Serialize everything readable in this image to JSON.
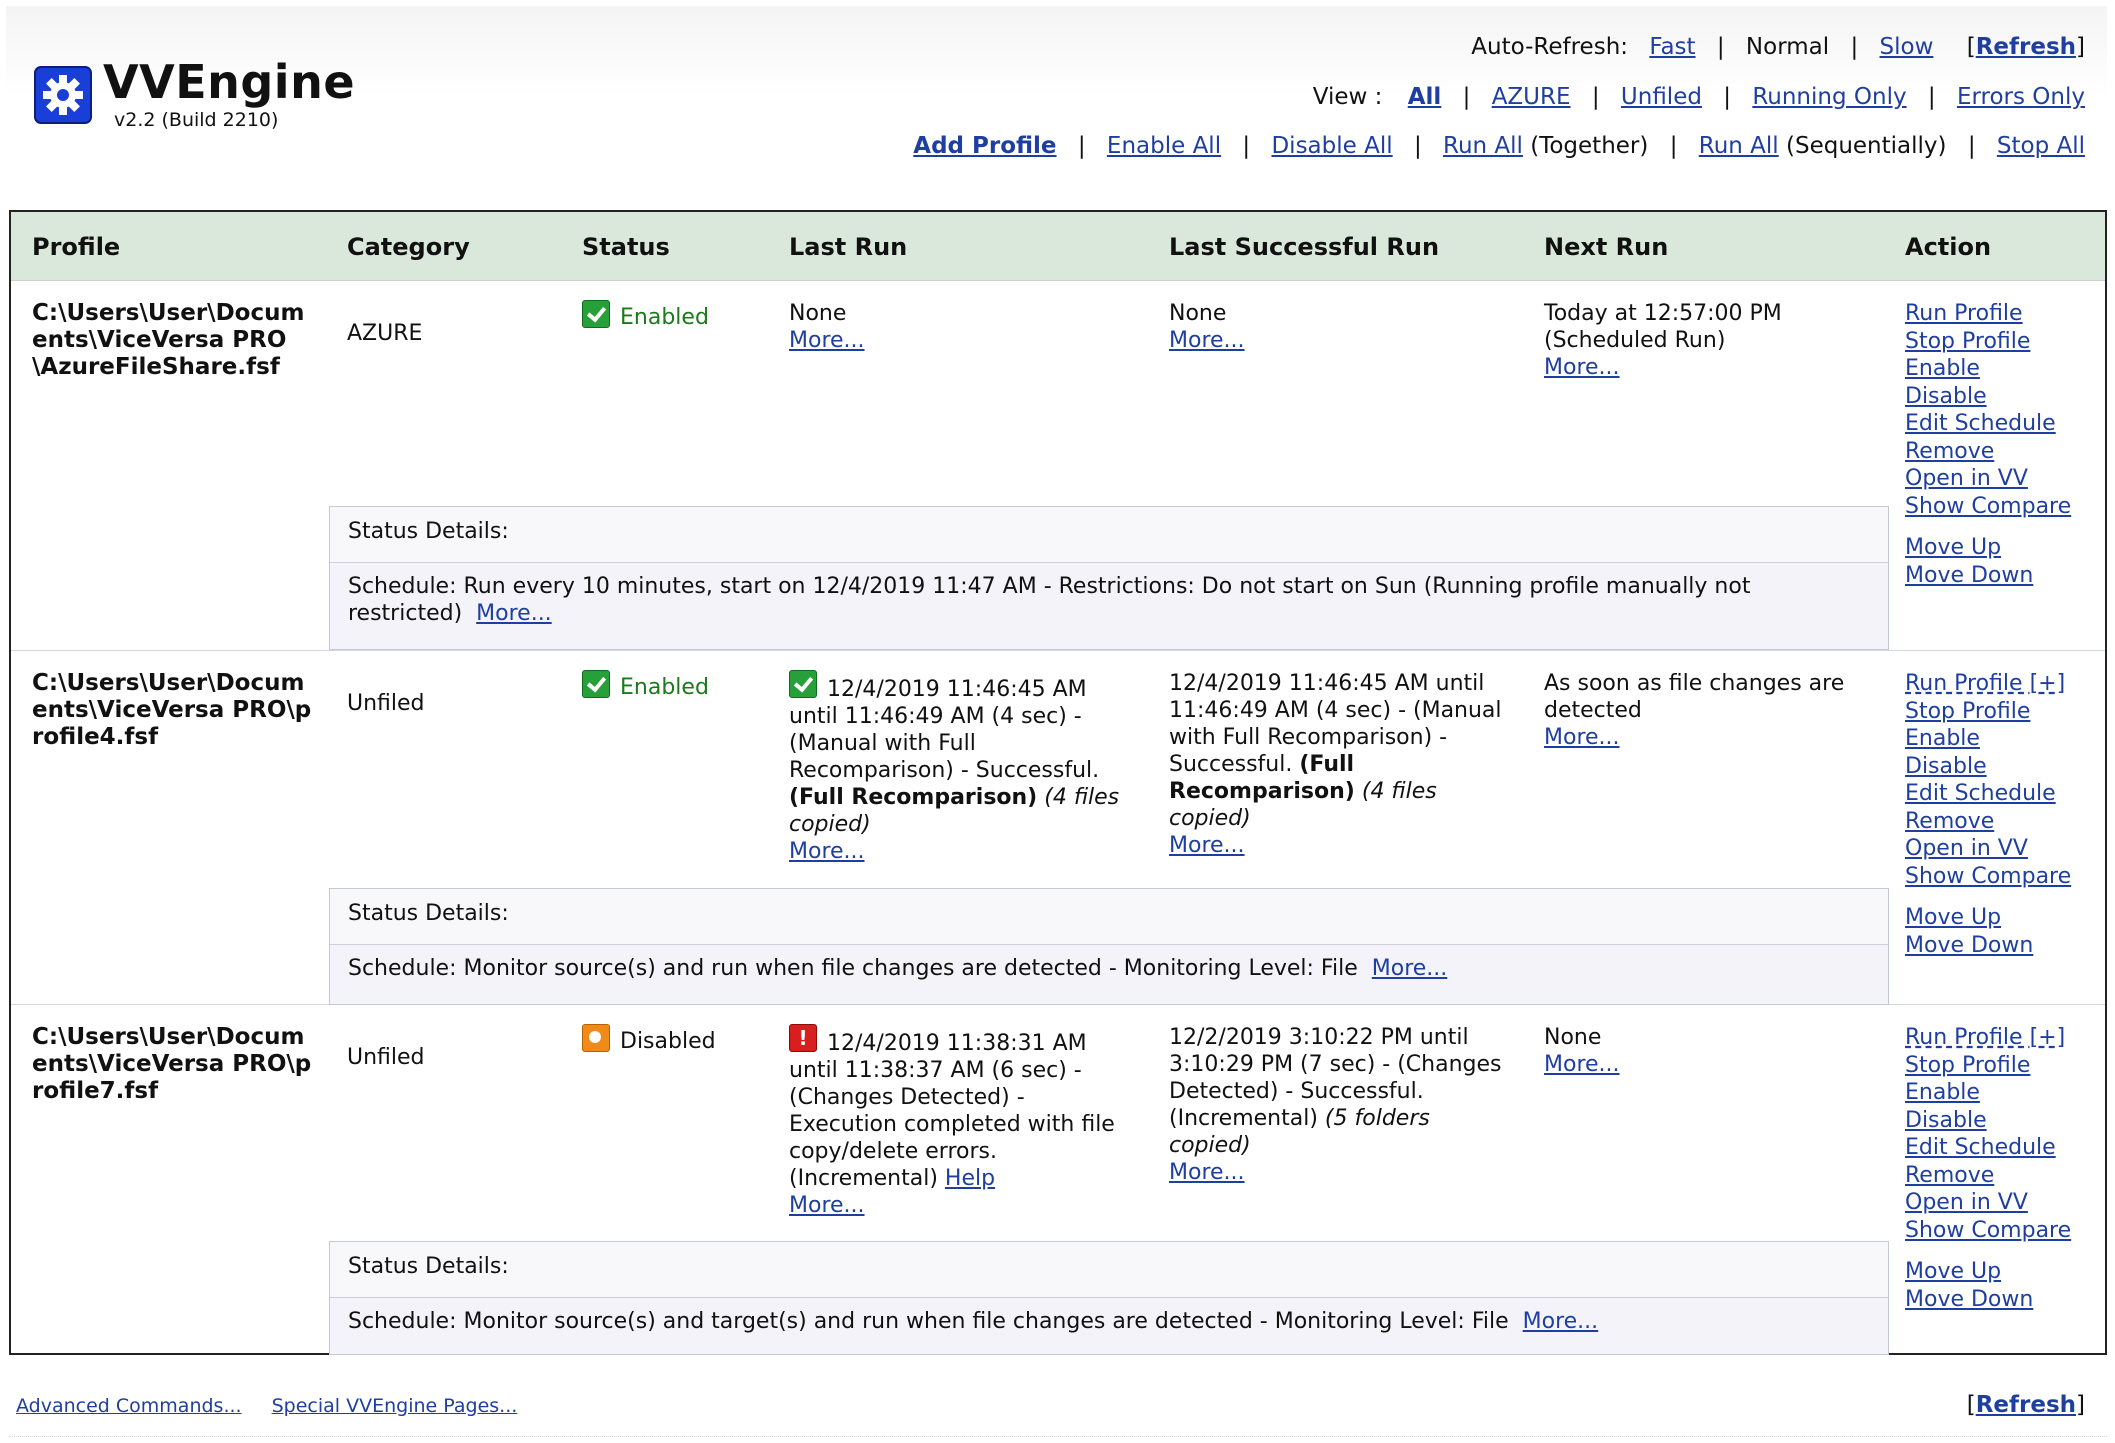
{
  "app": {
    "title": "VVEngine",
    "version": "v2.2 (Build 2210)",
    "logo_icon": "gear-icon"
  },
  "controls": {
    "auto_refresh_label": "Auto-Refresh:",
    "fast": "Fast",
    "normal": "Normal",
    "slow": "Slow",
    "refresh": "Refresh",
    "view_label": "View :",
    "view_all": "All",
    "view_azure": "AZURE",
    "view_unfiled": "Unfiled",
    "view_running": "Running Only",
    "view_errors": "Errors Only",
    "add_profile": "Add Profile",
    "enable_all": "Enable All",
    "disable_all": "Disable All",
    "run_all_1": "Run All",
    "together": "(Together)",
    "run_all_2": "Run All",
    "sequentially": "(Sequentially)",
    "stop_all": "Stop All"
  },
  "columns": {
    "profile": "Profile",
    "category": "Category",
    "status": "Status",
    "last_run": "Last Run",
    "last_success": "Last Successful Run",
    "next_run": "Next Run",
    "action": "Action"
  },
  "common": {
    "more": "More...",
    "status_details": "Status Details:",
    "help": "Help"
  },
  "profiles": [
    {
      "path": "C:\\Users\\User\\Documents\\ViceVersa PRO\\AzureFileShare.fsf",
      "category": "AZURE",
      "status": "Enabled",
      "last_run": "None",
      "last_success": "None",
      "next_run_1": "Today at 12:57:00 PM",
      "next_run_2": "(Scheduled Run)",
      "schedule": "Schedule: Run every 10 minutes, start on 12/4/2019 11:47 AM - Restrictions: Do not start on Sun (Running profile manually not restricted)",
      "actions": [
        "Run Profile",
        "Stop Profile",
        "Enable",
        "Disable",
        "Edit Schedule",
        "Remove",
        "Open in VV",
        "Show Compare",
        "Move Up",
        "Move Down"
      ]
    },
    {
      "path": "C:\\Users\\User\\Documents\\ViceVersa PRO\\profile4.fsf",
      "category": "Unfiled",
      "status": "Enabled",
      "last_run_main": "12/4/2019 11:46:45 AM until 11:46:49 AM (4 sec) - (Manual with Full Recomparison) - Successful.",
      "last_run_bold": "(Full Recomparison)",
      "last_run_italic": "(4 files copied)",
      "last_success_main": "12/4/2019 11:46:45 AM until 11:46:49 AM (4 sec) - (Manual with Full Recomparison) - Successful.",
      "last_success_bold": "(Full Recomparison)",
      "last_success_italic": "(4 files copied)",
      "next_run": "As soon as file changes are detected",
      "schedule": "Schedule: Monitor source(s) and run when file changes are detected - Monitoring Level: File",
      "actions": [
        "Run Profile [+]",
        "Stop Profile",
        "Enable",
        "Disable",
        "Edit Schedule",
        "Remove",
        "Open in VV",
        "Show Compare",
        "Move Up",
        "Move Down"
      ]
    },
    {
      "path": "C:\\Users\\User\\Documents\\ViceVersa PRO\\profile7.fsf",
      "category": "Unfiled",
      "status": "Disabled",
      "last_run_main": "12/4/2019 11:38:31 AM until 11:38:37 AM (6 sec) - (Changes Detected) - Execution completed with file copy/delete errors. (Incremental)",
      "last_success_main": "12/2/2019 3:10:22 PM until 3:10:29 PM (7 sec) - (Changes Detected) - Successful. (Incremental)",
      "last_success_italic": "(5 folders copied)",
      "next_run": "None",
      "schedule": "Schedule: Monitor source(s) and target(s) and run when file changes are detected - Monitoring Level: File",
      "actions": [
        "Run Profile [+]",
        "Stop Profile",
        "Enable",
        "Disable",
        "Edit Schedule",
        "Remove",
        "Open in VV",
        "Show Compare",
        "Move Up",
        "Move Down"
      ]
    }
  ],
  "footer": {
    "advanced": "Advanced Commands...",
    "special": "Special VVEngine Pages...",
    "refresh": "Refresh"
  }
}
